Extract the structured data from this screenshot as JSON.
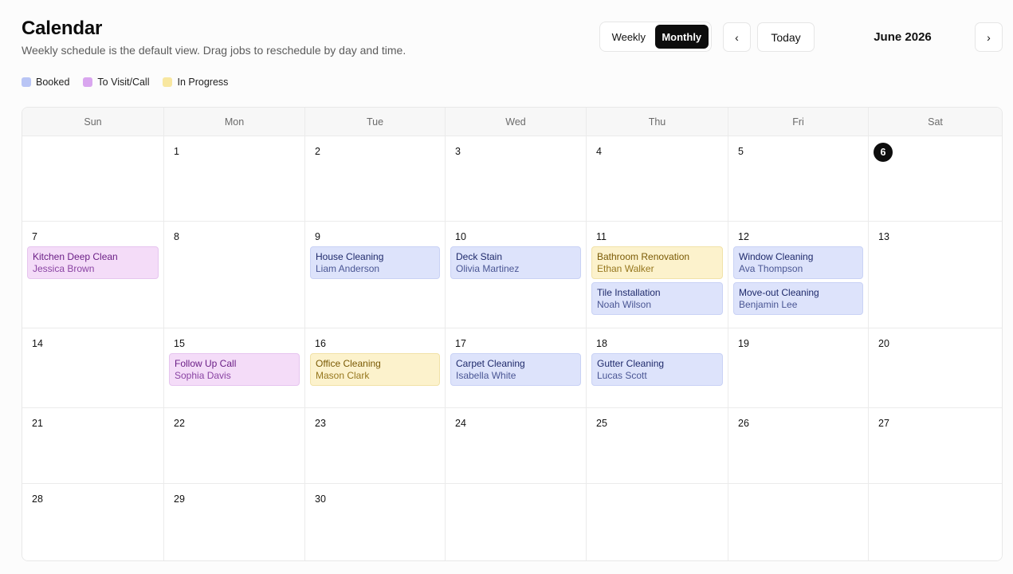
{
  "header": {
    "title": "Calendar",
    "subtitle": "Weekly schedule is the default view. Drag jobs to reschedule by day and time."
  },
  "view_toggle": {
    "weekly_label": "Weekly",
    "monthly_label": "Monthly",
    "selected": "Monthly"
  },
  "nav": {
    "prev_icon": "chevron-left-icon",
    "prev_glyph": "‹",
    "today_label": "Today",
    "month_label": "June 2026",
    "next_icon": "chevron-right-icon",
    "next_glyph": "›"
  },
  "legend": [
    {
      "label": "Booked",
      "color": "#b9c5f5"
    },
    {
      "label": "To Visit/Call",
      "color": "#d9a6ef"
    },
    {
      "label": "In Progress",
      "color": "#f8e7a0"
    }
  ],
  "weekdays": [
    "Sun",
    "Mon",
    "Tue",
    "Wed",
    "Thu",
    "Fri",
    "Sat"
  ],
  "today": "6",
  "weeks": [
    [
      "",
      "1",
      "2",
      "3",
      "4",
      "5",
      "6"
    ],
    [
      "7",
      "8",
      "9",
      "10",
      "11",
      "12",
      "13"
    ],
    [
      "14",
      "15",
      "16",
      "17",
      "18",
      "19",
      "20"
    ],
    [
      "21",
      "22",
      "23",
      "24",
      "25",
      "26",
      "27"
    ],
    [
      "28",
      "29",
      "30",
      "",
      "",
      "",
      ""
    ]
  ],
  "events": {
    "7": [
      {
        "title": "Kitchen Deep Clean",
        "client": "Jessica Brown",
        "status": "visit"
      }
    ],
    "9": [
      {
        "title": "House Cleaning",
        "client": "Liam Anderson",
        "status": "booked"
      }
    ],
    "10": [
      {
        "title": "Deck Stain",
        "client": "Olivia Martinez",
        "status": "booked"
      }
    ],
    "11": [
      {
        "title": "Bathroom Renovation",
        "client": "Ethan Walker",
        "status": "progress"
      },
      {
        "title": "Tile Installation",
        "client": "Noah Wilson",
        "status": "booked"
      }
    ],
    "12": [
      {
        "title": "Window Cleaning",
        "client": "Ava Thompson",
        "status": "booked"
      },
      {
        "title": "Move-out Cleaning",
        "client": "Benjamin Lee",
        "status": "booked"
      }
    ],
    "15": [
      {
        "title": "Follow Up Call",
        "client": "Sophia Davis",
        "status": "visit"
      }
    ],
    "16": [
      {
        "title": "Office Cleaning",
        "client": "Mason Clark",
        "status": "progress"
      }
    ],
    "17": [
      {
        "title": "Carpet Cleaning",
        "client": "Isabella White",
        "status": "booked"
      }
    ],
    "18": [
      {
        "title": "Gutter Cleaning",
        "client": "Lucas Scott",
        "status": "booked"
      }
    ]
  }
}
